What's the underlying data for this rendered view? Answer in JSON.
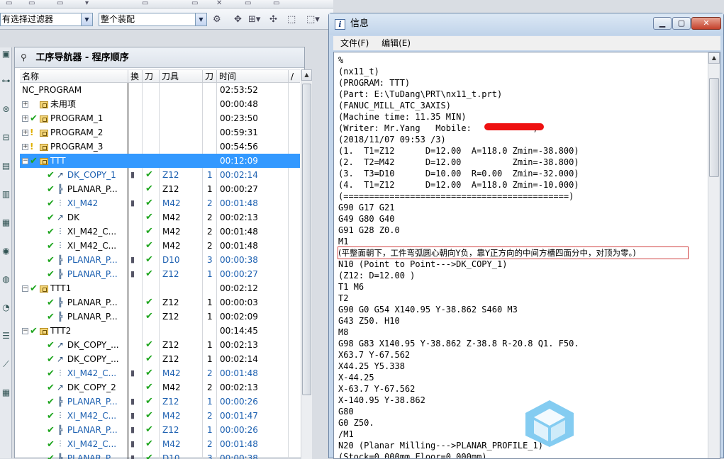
{
  "toolbar": {
    "filter_combo": "有选择过滤器",
    "assembly_combo": "整个装配"
  },
  "navigator": {
    "title": "工序导航器 - 程序顺序",
    "columns": [
      "名称",
      "换",
      "刀",
      "刀具",
      "刀",
      "时间",
      "/"
    ],
    "rows": [
      {
        "name": "NC_PROGRAM",
        "time": "02:53:52"
      },
      {
        "name": "未用项",
        "time": "00:00:48"
      },
      {
        "name": "PROGRAM_1",
        "time": "00:23:50"
      },
      {
        "name": "PROGRAM_2",
        "time": "00:59:31"
      },
      {
        "name": "PROGRAM_3",
        "time": "00:54:56"
      },
      {
        "name": "TTT",
        "time": "00:12:09"
      },
      {
        "name": "DK_COPY_1",
        "tool": "Z12",
        "num": "1",
        "time": "00:02:14"
      },
      {
        "name": "PLANAR_P...",
        "tool": "Z12",
        "num": "1",
        "time": "00:00:27"
      },
      {
        "name": "XI_M42",
        "tool": "M42",
        "num": "2",
        "time": "00:01:48"
      },
      {
        "name": "DK",
        "tool": "M42",
        "num": "2",
        "time": "00:02:13"
      },
      {
        "name": "XI_M42_C...",
        "tool": "M42",
        "num": "2",
        "time": "00:01:48"
      },
      {
        "name": "XI_M42_C...",
        "tool": "M42",
        "num": "2",
        "time": "00:01:48"
      },
      {
        "name": "PLANAR_P...",
        "tool": "D10",
        "num": "3",
        "time": "00:00:38"
      },
      {
        "name": "PLANAR_P...",
        "tool": "Z12",
        "num": "1",
        "time": "00:00:27"
      },
      {
        "name": "TTT1",
        "time": "00:02:12"
      },
      {
        "name": "PLANAR_P...",
        "tool": "Z12",
        "num": "1",
        "time": "00:00:03"
      },
      {
        "name": "PLANAR_P...",
        "tool": "Z12",
        "num": "1",
        "time": "00:02:09"
      },
      {
        "name": "TTT2",
        "time": "00:14:45"
      },
      {
        "name": "DK_COPY_...",
        "tool": "Z12",
        "num": "1",
        "time": "00:02:13"
      },
      {
        "name": "DK_COPY_...",
        "tool": "Z12",
        "num": "1",
        "time": "00:02:14"
      },
      {
        "name": "XI_M42_C...",
        "tool": "M42",
        "num": "2",
        "time": "00:01:48"
      },
      {
        "name": "DK_COPY_2",
        "tool": "M42",
        "num": "2",
        "time": "00:02:13"
      },
      {
        "name": "PLANAR_P...",
        "tool": "Z12",
        "num": "1",
        "time": "00:00:26"
      },
      {
        "name": "XI_M42_C...",
        "tool": "M42",
        "num": "2",
        "time": "00:01:47"
      },
      {
        "name": "PLANAR_P...",
        "tool": "Z12",
        "num": "1",
        "time": "00:00:26"
      },
      {
        "name": "XI_M42_C...",
        "tool": "M42",
        "num": "2",
        "time": "00:01:48"
      },
      {
        "name": "PLANAR_P...",
        "tool": "D10",
        "num": "3",
        "time": "00:00:38"
      }
    ]
  },
  "info_window": {
    "title": "信息",
    "menu": [
      "文件(F)",
      "编辑(E)"
    ],
    "lines": [
      "%",
      "(nx11_t)",
      "(PROGRAM: TTT)",
      "(Part: E:\\TuDang\\PRT\\nx11_t.prt)",
      "(FANUC_MILL_ATC_3AXIS)",
      "(Machine time: 11.35 MIN)",
      "(Writer: Mr.Yang   Mobile:            )",
      "(2018/11/07 09:53 /3)",
      "(1.  T1=Z12      D=12.00  A=118.0 Zmin=-38.800)",
      "(2.  T2=M42      D=12.00          Zmin=-38.800)",
      "(3.  T3=D10      D=10.00  R=0.00  Zmin=-32.000)",
      "(4.  T1=Z12      D=12.00  A=118.0 Zmin=-10.000)",
      "(============================================)",
      "G90 G17 G21",
      "G49 G80 G40",
      "G91 G28 Z0.0",
      "M1",
      "(平整面朝下，工件弯弧圆心朝向Y负，靠Y正方向的中间方槽四面分中，对顶为零。)",
      "N10 (Point to Point--->DK_COPY_1)",
      "(Z12: D=12.00 )",
      "T1 M6",
      "T2",
      "G90 G0 G54 X140.95 Y-38.862 S460 M3",
      "G43 Z50. H10",
      "M8",
      "G98 G83 X140.95 Y-38.862 Z-38.8 R-20.8 Q1. F50.",
      "X63.7 Y-67.562",
      "X44.25 Y5.338",
      "X-44.25",
      "X-63.7 Y-67.562",
      "X-140.95 Y-38.862",
      "G80",
      "G0 Z50.",
      "/M1",
      "N20 (Planar Milling--->PLANAR_PROFILE_1)",
      "(Stock=0.000mm Floor=0.000mm)"
    ]
  }
}
